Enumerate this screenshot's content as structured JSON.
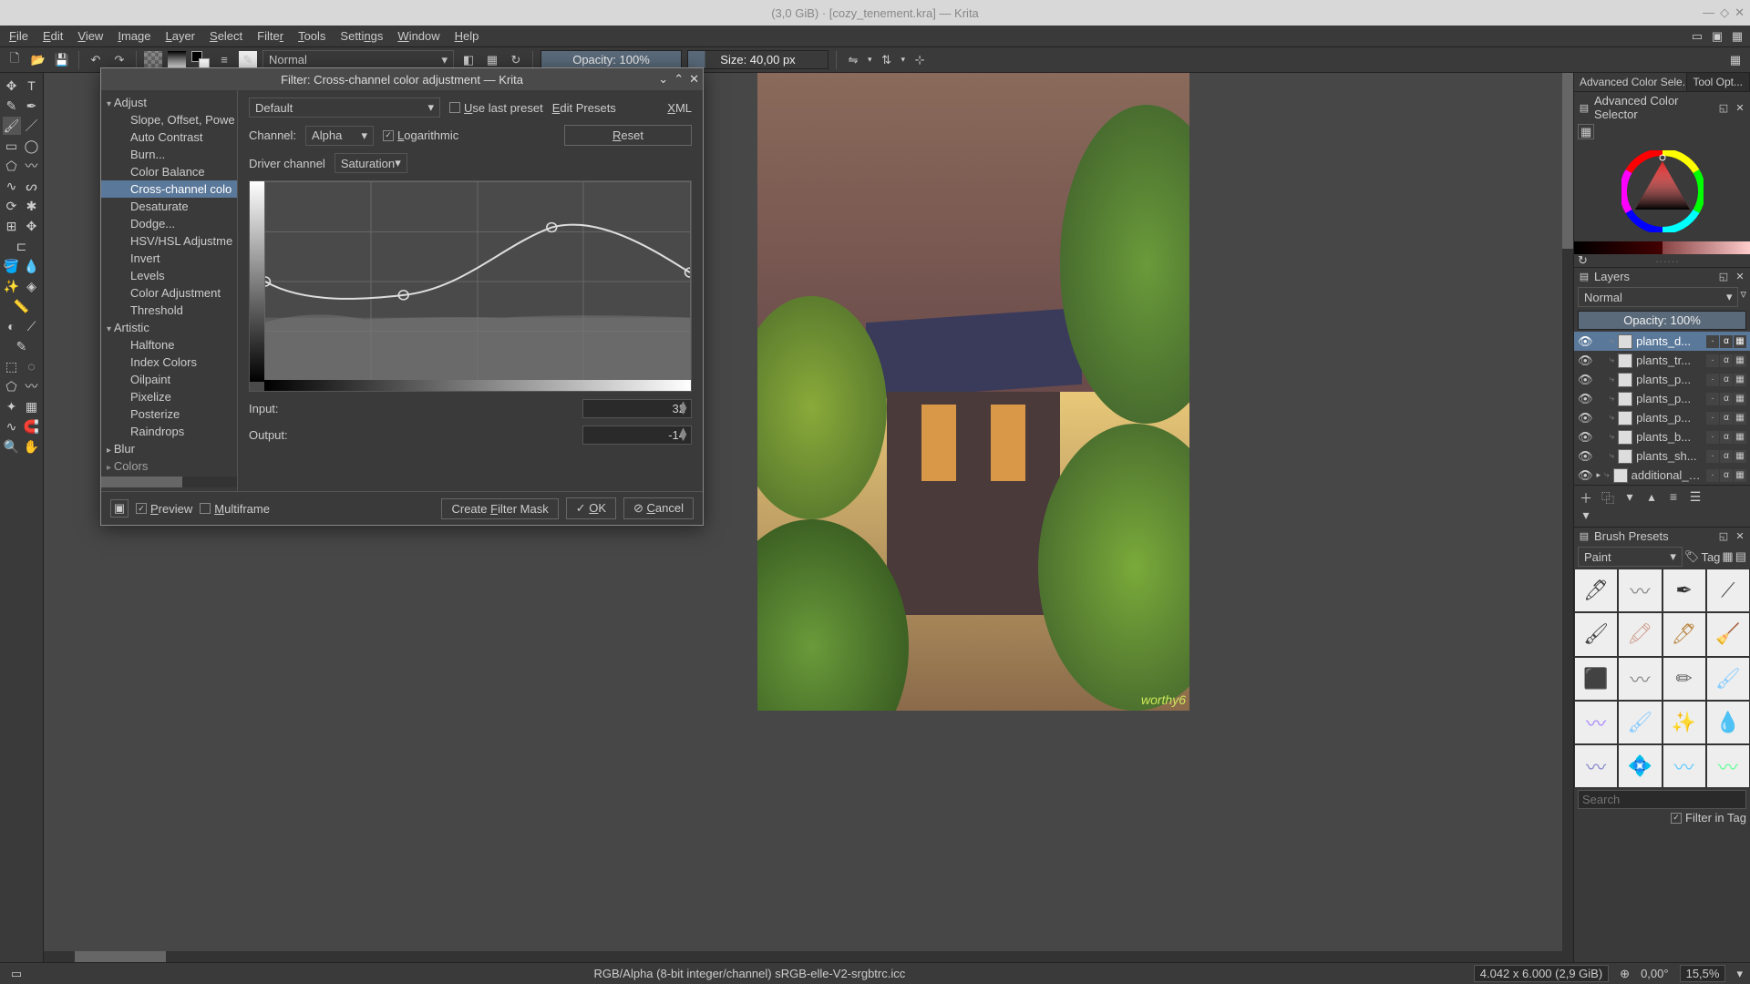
{
  "titlebar": {
    "text": "(3,0 GiB) · [cozy_tenement.kra] — Krita"
  },
  "menubar": {
    "items": [
      "File",
      "Edit",
      "View",
      "Image",
      "Layer",
      "Select",
      "Filter",
      "Tools",
      "Settings",
      "Window",
      "Help"
    ]
  },
  "toolbar": {
    "blend_mode": "Normal",
    "opacity": "Opacity: 100%",
    "size": "Size: 40,00 px"
  },
  "right_dock": {
    "tabs": [
      "Advanced Color Sele...",
      "Tool Opt..."
    ],
    "color_selector_title": "Advanced Color Selector"
  },
  "layers": {
    "title": "Layers",
    "blend": "Normal",
    "opacity": "Opacity:  100%",
    "items": [
      {
        "name": "plants_d...",
        "sel": true
      },
      {
        "name": "plants_tr..."
      },
      {
        "name": "plants_p..."
      },
      {
        "name": "plants_p..."
      },
      {
        "name": "plants_p..."
      },
      {
        "name": "plants_b..."
      },
      {
        "name": "plants_sh..."
      },
      {
        "name": "additional_ob..."
      }
    ]
  },
  "brush_presets": {
    "title": "Brush Presets",
    "category": "Paint",
    "tag_label": "Tag",
    "search_placeholder": "Search",
    "filter_label": "Filter in Tag"
  },
  "statusbar": {
    "colorspace": "RGB/Alpha (8-bit integer/channel)  sRGB-elle-V2-srgbtrc.icc",
    "dims": "4.042 x 6.000 (2,9 GiB)",
    "rotation": "0,00°",
    "zoom": "15,5%"
  },
  "dialog": {
    "title": "Filter: Cross-channel color adjustment — Krita",
    "categories": {
      "adjust": "Adjust",
      "adjust_items": [
        "Slope, Offset, Powe",
        "Auto Contrast",
        "Burn...",
        "Color Balance",
        "Cross-channel colo",
        "Desaturate",
        "Dodge...",
        "HSV/HSL Adjustme",
        "Invert",
        "Levels",
        "Color Adjustment",
        "Threshold"
      ],
      "artistic": "Artistic",
      "artistic_items": [
        "Halftone",
        "Index Colors",
        "Oilpaint",
        "Pixelize",
        "Posterize",
        "Raindrops"
      ],
      "blur": "Blur",
      "colors": "Colors"
    },
    "preset": "Default",
    "use_last": "Use last preset",
    "edit_presets": "Edit Presets",
    "xml": "XML",
    "channel_label": "Channel:",
    "channel": "Alpha",
    "logarithmic": "Logarithmic",
    "reset": "Reset",
    "driver_label": "Driver channel",
    "driver": "Saturation",
    "input_label": "Input:",
    "input_value": "32",
    "output_label": "Output:",
    "output_value": "-14",
    "preview": "Preview",
    "multiframe": "Multiframe",
    "create_mask": "Create Filter Mask",
    "ok": "OK",
    "cancel": "Cancel"
  }
}
